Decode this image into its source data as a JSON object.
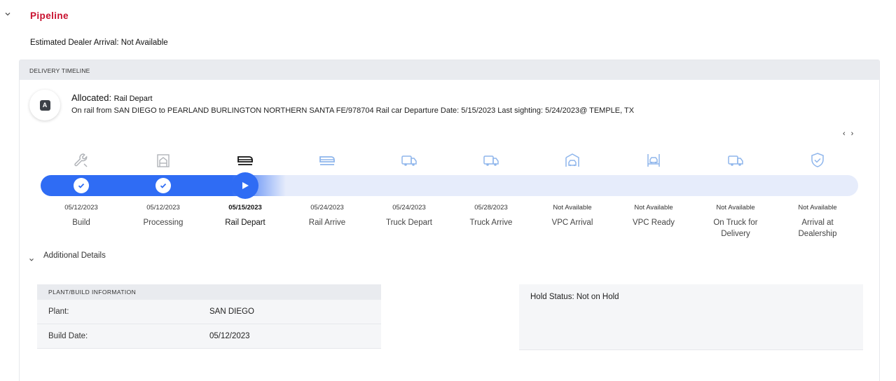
{
  "pipeline": {
    "title": "Pipeline",
    "estimated_arrival": "Estimated Dealer Arrival: Not Available"
  },
  "timeline": {
    "header": "DELIVERY TIMELINE",
    "status_badge": "A",
    "status_state": "Allocated:",
    "status_step": "Rail Depart",
    "status_description": "On rail from SAN DIEGO to PEARLAND BURLINGTON NORTHERN SANTA FE/978704 Rail car Departure Date: 5/15/2023 Last sighting: 5/24/2023@ TEMPLE, TX",
    "pager_prev": "‹",
    "pager_next": "›",
    "progress_completed_steps": 2,
    "progress_current_step_index": 2,
    "steps": [
      {
        "date": "05/12/2023",
        "label": "Build",
        "icon": "wrench-icon",
        "state": "complete"
      },
      {
        "date": "05/12/2023",
        "label": "Processing",
        "icon": "factory-icon",
        "state": "complete"
      },
      {
        "date": "05/15/2023",
        "label": "Rail Depart",
        "icon": "train-icon",
        "state": "current"
      },
      {
        "date": "05/24/2023",
        "label": "Rail Arrive",
        "icon": "train-icon",
        "state": "upcoming"
      },
      {
        "date": "05/24/2023",
        "label": "Truck Depart",
        "icon": "truck-icon",
        "state": "upcoming"
      },
      {
        "date": "05/28/2023",
        "label": "Truck Arrive",
        "icon": "truck-icon",
        "state": "upcoming"
      },
      {
        "date": "Not Available",
        "label": "VPC Arrival",
        "icon": "car-garage-icon",
        "state": "upcoming"
      },
      {
        "date": "Not Available",
        "label": "VPC Ready",
        "icon": "car-lift-icon",
        "state": "upcoming"
      },
      {
        "date": "Not Available",
        "label": "On Truck for Delivery",
        "icon": "truck-icon",
        "state": "upcoming"
      },
      {
        "date": "Not Available",
        "label": "Arrival at Dealership",
        "icon": "shield-check-icon",
        "state": "upcoming"
      }
    ]
  },
  "additional_details": {
    "title": "Additional Details",
    "plant_table": {
      "header": "PLANT/BUILD INFORMATION",
      "rows": [
        {
          "key": "Plant:",
          "value": "SAN DIEGO"
        },
        {
          "key": "Build Date:",
          "value": "05/12/2023"
        }
      ]
    },
    "hold_status": "Hold Status: Not on Hold"
  },
  "colors": {
    "brand_red": "#c8102e",
    "progress_blue": "#2f6cf4",
    "track_light": "#e6ecfb",
    "upcoming_icon": "#8fb6ec",
    "complete_icon": "#b0b3b8"
  }
}
